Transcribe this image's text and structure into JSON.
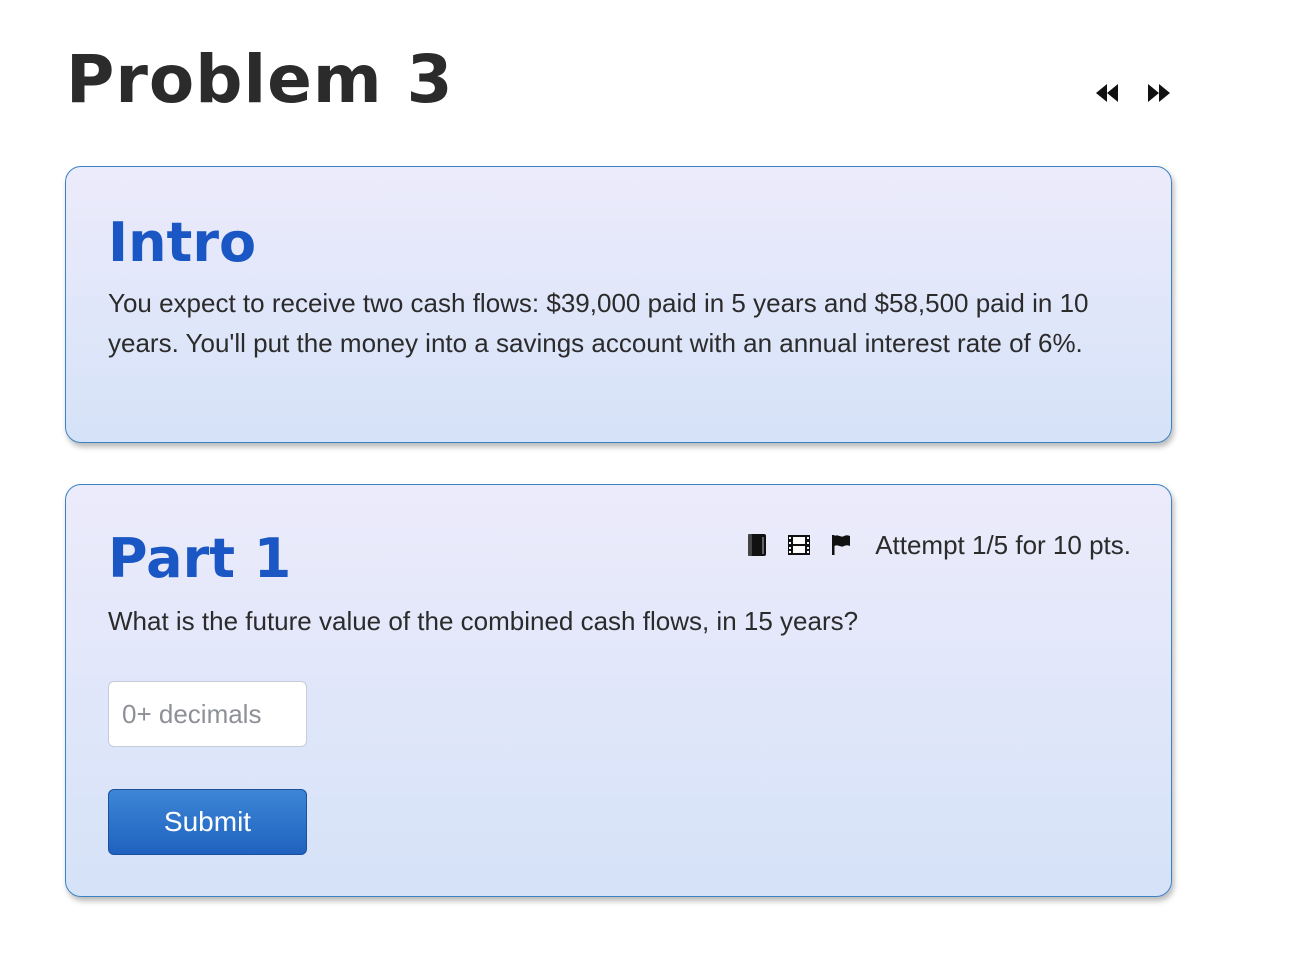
{
  "header": {
    "title": "Problem 3",
    "nav": {
      "prev_icon": "rewind-icon",
      "next_icon": "fast-forward-icon"
    }
  },
  "intro": {
    "heading": "Intro",
    "text": "You expect to receive two cash flows: $39,000 paid in 5 years and $58,500 paid in 10 years. You'll put the money into a savings account with an annual interest rate of 6%."
  },
  "part": {
    "heading": "Part 1",
    "tools": {
      "book_icon": "book-icon",
      "film_icon": "film-icon",
      "flag_icon": "flag-icon"
    },
    "attempt": "Attempt 1/5 for 10 pts.",
    "question": "What is the future value of the combined cash flows, in 15 years?",
    "answer": {
      "value": "",
      "placeholder": "0+ decimals"
    },
    "submit_label": "Submit"
  },
  "colors": {
    "heading_blue": "#1a56c4",
    "card_border": "#3b82c4",
    "button_blue": "#2a6fcc",
    "text": "#2b2b2b"
  }
}
